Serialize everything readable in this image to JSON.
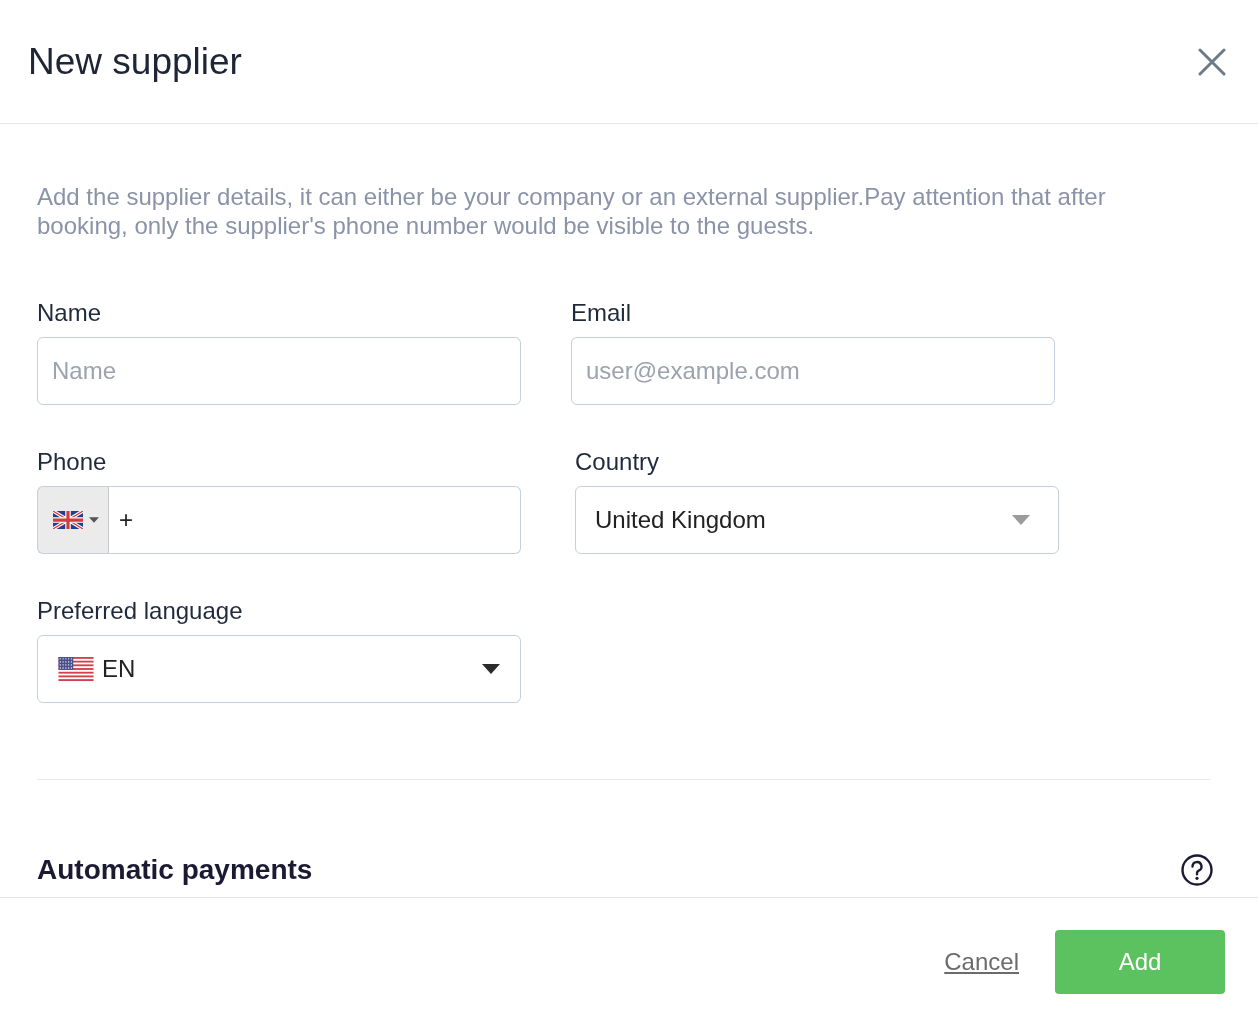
{
  "dialog": {
    "title": "New supplier"
  },
  "description": "Add the supplier details, it can either be your company or an external supplier.Pay attention that after booking, only the supplier's phone number would be visible to the guests.",
  "fields": [
    {
      "kind": "input",
      "label": "Name",
      "placeholder": "Name"
    },
    {
      "kind": "input",
      "label": "Email",
      "placeholder": "user@example.com"
    },
    {
      "kind": "phone",
      "label": "Phone",
      "value": "+"
    },
    {
      "kind": "select",
      "label": "Country",
      "value": "United Kingdom"
    },
    {
      "kind": "language",
      "label": "Preferred language",
      "value": "EN"
    }
  ],
  "section": {
    "title": "Automatic payments"
  },
  "footer": {
    "buttons": [
      {
        "kind": "link",
        "label": "Cancel"
      },
      {
        "kind": "primary",
        "label": "Add"
      }
    ]
  }
}
